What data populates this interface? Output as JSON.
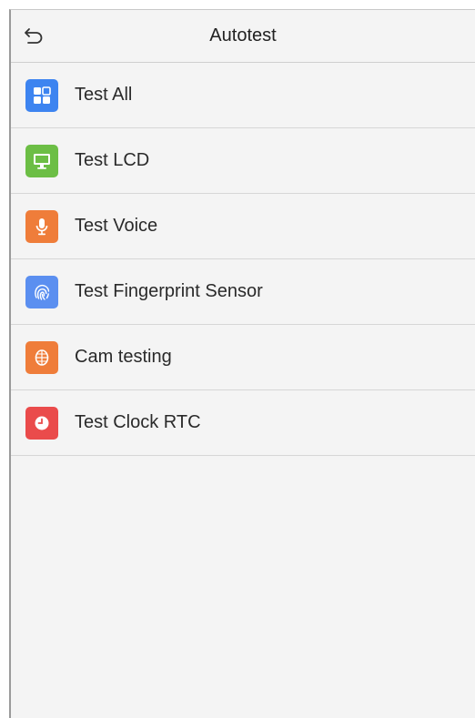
{
  "header": {
    "title": "Autotest",
    "back_icon": "back-arrow-icon"
  },
  "menu": {
    "items": [
      {
        "label": "Test All",
        "icon": "grid-icon",
        "color": "#3d84f0"
      },
      {
        "label": "Test LCD",
        "icon": "monitor-icon",
        "color": "#6cbe45"
      },
      {
        "label": "Test Voice",
        "icon": "microphone-icon",
        "color": "#ef7d3a"
      },
      {
        "label": "Test Fingerprint Sensor",
        "icon": "fingerprint-icon",
        "color": "#5b8ff0"
      },
      {
        "label": "Cam testing",
        "icon": "face-icon",
        "color": "#ef7d3a"
      },
      {
        "label": "Test Clock RTC",
        "icon": "clock-icon",
        "color": "#ea4b4b"
      }
    ]
  },
  "colors": {
    "background": "#f4f4f4",
    "divider": "#d6d6d6",
    "text": "#2a2a2a"
  }
}
